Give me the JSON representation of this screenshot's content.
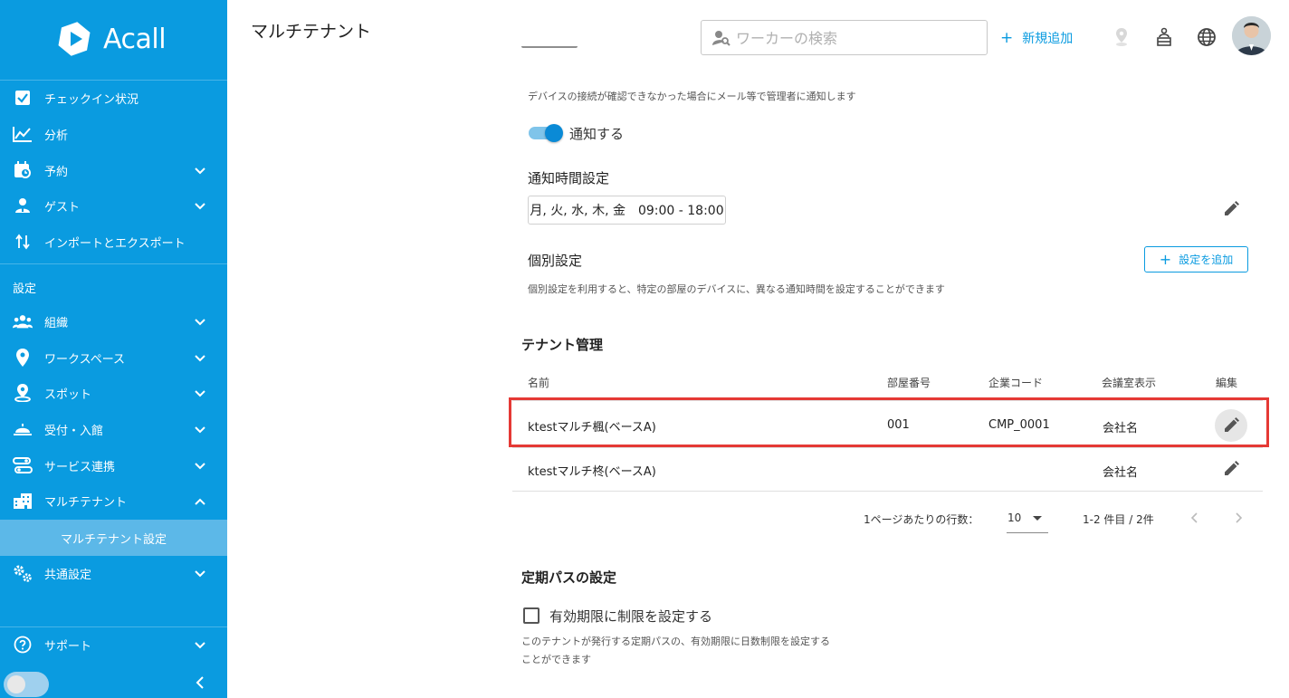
{
  "sidebar": {
    "logo_text": "Acall",
    "items": [
      {
        "label": "チェックイン状況",
        "icon": "checkbox-icon"
      },
      {
        "label": "分析",
        "icon": "chart-line-icon"
      },
      {
        "label": "予約",
        "icon": "calendar-clock-icon"
      },
      {
        "label": "ゲスト",
        "icon": "guest-icon"
      },
      {
        "label": "インポートとエクスポート",
        "icon": "import-export-icon"
      }
    ],
    "section_label": "設定",
    "settings_items": [
      {
        "label": "組織",
        "icon": "people-icon"
      },
      {
        "label": "ワークスペース",
        "icon": "location-pin-icon"
      },
      {
        "label": "スポット",
        "icon": "spot-pin-icon"
      },
      {
        "label": "受付・入館",
        "icon": "reception-bell-icon"
      },
      {
        "label": "サービス連携",
        "icon": "integration-icon"
      },
      {
        "label": "マルチテナント",
        "icon": "building-icon"
      }
    ],
    "sub_item": "マルチテナント設定",
    "common_settings": "共通設定",
    "support": "サポート"
  },
  "header": {
    "title": "マルチテナント",
    "search_placeholder": "ワーカーの検索",
    "add_new": "新規追加"
  },
  "notification": {
    "description": "デバイスの接続が確認できなかった場合にメール等で管理者に通知します",
    "toggle_label": "通知する",
    "toggle_on": true,
    "time_heading": "通知時間設定",
    "time_value": "月, 火, 水, 木, 金　09:00 - 18:00",
    "individual_heading": "個別設定",
    "add_setting_button": "設定を追加",
    "individual_description": "個別設定を利用すると、特定の部屋のデバイスに、異なる通知時間を設定することができます"
  },
  "tenant": {
    "heading": "テナント管理",
    "columns": [
      "名前",
      "部屋番号",
      "企業コード",
      "会議室表示",
      "編集"
    ],
    "rows": [
      {
        "name": "ktestマルチ楓(ベースA)",
        "room": "001",
        "code": "CMP_0001",
        "display": "会社名"
      },
      {
        "name": "ktestマルチ柊(ベースA)",
        "room": "",
        "code": "",
        "display": "会社名"
      }
    ],
    "rows_per_page_label": "1ページあたりの行数：",
    "rows_per_page": "10",
    "range": "1-2 件目 / 2件"
  },
  "pass": {
    "heading": "定期パスの設定",
    "checkbox_label": "有効期限に制限を設定する",
    "checked": false,
    "description_line1": "このテナントが発行する定期パスの、有効期限に日数制限を設定する",
    "description_line2": "ことができます"
  },
  "colors": {
    "sidebar": "#0a9be0",
    "sidebar_active": "#5cb8e8",
    "accent": "#0a9be0",
    "highlight_border": "#e53935"
  }
}
